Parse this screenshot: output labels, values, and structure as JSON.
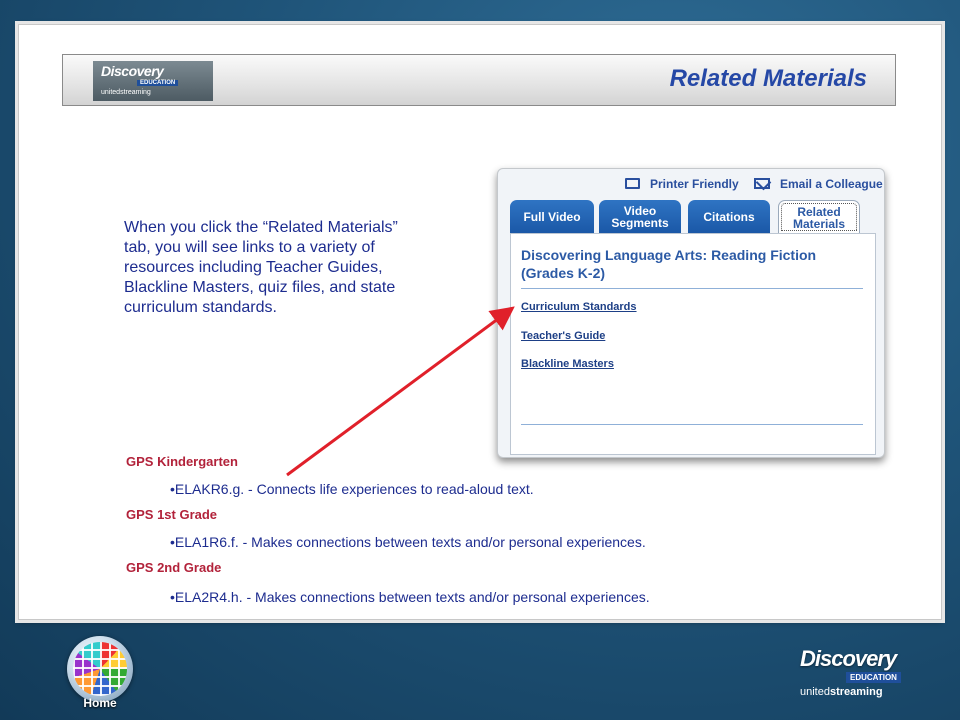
{
  "header": {
    "logo_word": "Discovery",
    "logo_edu": "EDUCATION",
    "logo_sub": "unitedstreaming",
    "title": "Related Materials"
  },
  "description": "When you click the “Related Materials” tab, you will see links to a variety of resources including Teacher Guides, Blackline Masters, quiz files, and state curriculum standards.",
  "screenshot": {
    "printer_friendly": "Printer Friendly",
    "email_colleague": "Email a Colleague",
    "tabs": [
      {
        "label": "Full Video"
      },
      {
        "label": "Video Segments"
      },
      {
        "label": "Citations"
      },
      {
        "label": "Related Materials",
        "active": true
      }
    ],
    "heading": "Discovering Language Arts: Reading Fiction (Grades K-2)",
    "links": [
      "Curriculum Standards",
      "Teacher's Guide",
      "Blackline Masters"
    ]
  },
  "gps": [
    {
      "heading": "GPS Kindergarten",
      "item": "•ELAKR6.g. - Connects life experiences to read-aloud text."
    },
    {
      "heading": "GPS 1st Grade",
      "item": "•ELA1R6.f.   - Makes connections between texts and/or personal experiences."
    },
    {
      "heading": "GPS 2nd Grade",
      "item": "•ELA2R4.h.   - Makes connections between texts and/or personal experiences."
    }
  ],
  "footer": {
    "home_label": "Home",
    "brand_word": "Discovery",
    "brand_edu": "EDUCATION",
    "brand_sub_1": "united",
    "brand_sub_2": "streaming"
  },
  "colors": {
    "title_blue": "#2548a6",
    "text_navy": "#1d2c8f",
    "gps_red": "#b2223a",
    "arrow_red": "#e0202a",
    "tab_blue": "#2f74c3"
  }
}
